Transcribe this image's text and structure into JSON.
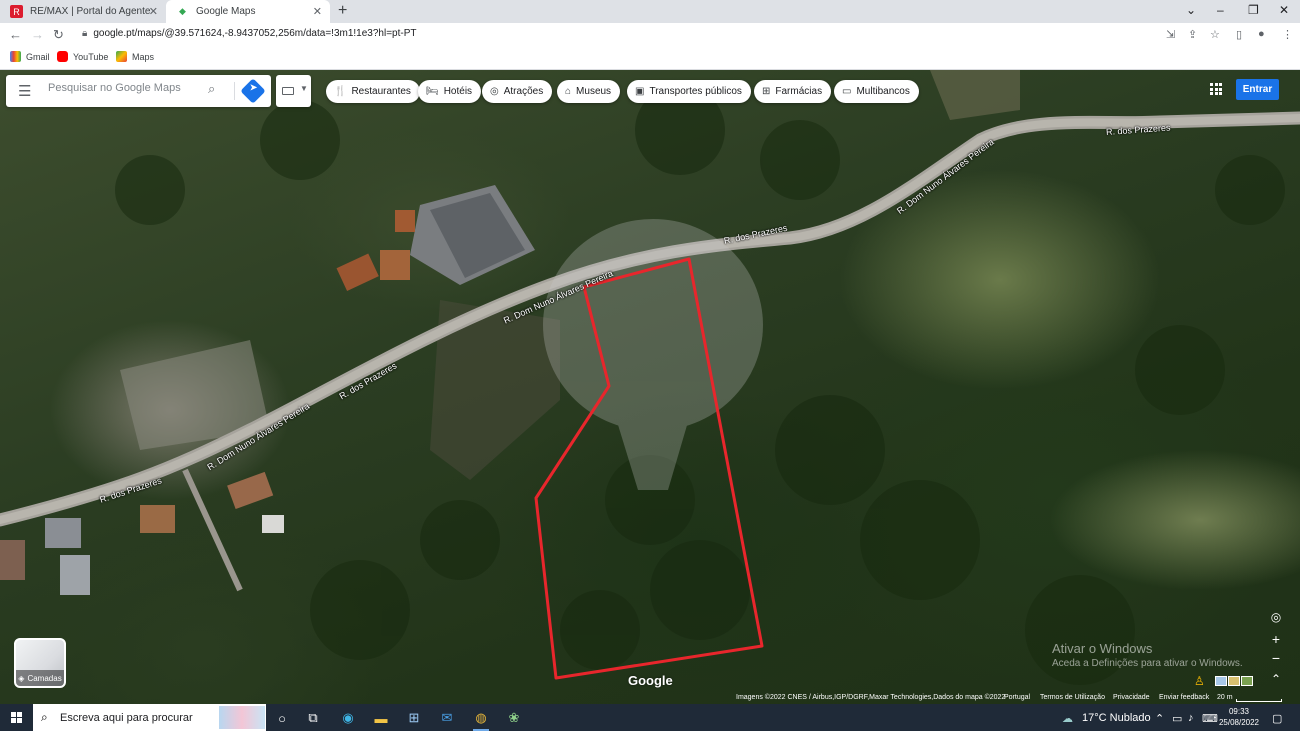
{
  "browser": {
    "tabs": [
      {
        "title": "RE/MAX | Portal do Agente",
        "favicon": "remax-icon"
      },
      {
        "title": "Google Maps",
        "favicon": "maps-pin-icon",
        "active": true
      }
    ],
    "url": "google.pt/maps/@39.571624,-8.9437052,256m/data=!3m1!1e3?hl=pt-PT",
    "bookmarks": [
      "Gmail",
      "YouTube",
      "Maps"
    ]
  },
  "map": {
    "search_placeholder": "Pesquisar no Google Maps",
    "chips": [
      {
        "label": "Restaurantes",
        "icon": "fork-knife-icon",
        "glyph": "🍴"
      },
      {
        "label": "Hotéis",
        "icon": "bed-icon",
        "glyph": "🛏"
      },
      {
        "label": "Atrações",
        "icon": "camera-icon",
        "glyph": "◎"
      },
      {
        "label": "Museus",
        "icon": "museum-icon",
        "glyph": "⌂"
      },
      {
        "label": "Transportes públicos",
        "icon": "bus-icon",
        "glyph": "▣"
      },
      {
        "label": "Farmácias",
        "icon": "pharmacy-icon",
        "glyph": "⊞"
      },
      {
        "label": "Multibancos",
        "icon": "atm-icon",
        "glyph": "▭"
      }
    ],
    "signin_label": "Entrar",
    "layers_label": "Camadas",
    "road_labels": [
      "R. dos Prazeres",
      "R. Dom Nuno Álvares Pereira",
      "R. dos Prazeres",
      "R. Dom Nuno Álvares Pereira",
      "R. dos Prazeres",
      "R. dos Prazeres",
      "R. Dom Nuno Álvares Pereira"
    ],
    "google_logo": "Google",
    "watermark_line1": "Ativar o Windows",
    "watermark_line2": "Aceda a Definições para ativar o Windows.",
    "footer": {
      "imagery": "Imagens ©2022 CNES / Airbus,IGP/DGRF,Maxar Technologies,Dados do mapa ©2022",
      "country": "Portugal",
      "terms": "Termos de Utilização",
      "privacy": "Privacidade",
      "feedback": "Enviar feedback",
      "scale": "20 m"
    },
    "parcel_outline_color": "#e8262c"
  },
  "taskbar": {
    "search_placeholder": "Escreva aqui para procurar",
    "weather": "17°C  Nublado",
    "time": "09:33",
    "date": "25/08/2022"
  }
}
